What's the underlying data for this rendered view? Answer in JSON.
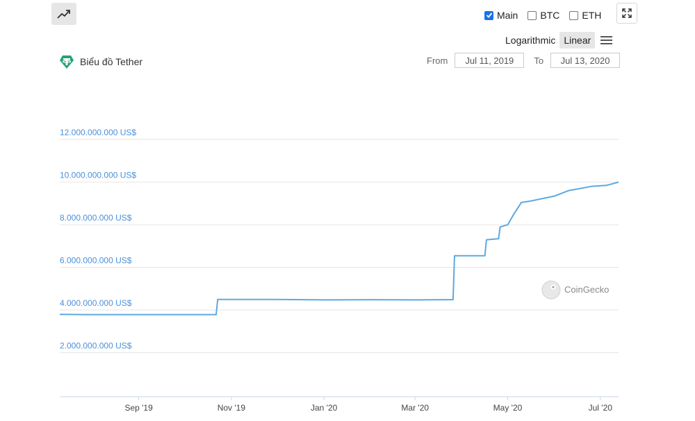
{
  "toolbar": {
    "series_toggles": [
      {
        "label": "Main",
        "checked": true
      },
      {
        "label": "BTC",
        "checked": false
      },
      {
        "label": "ETH",
        "checked": false
      }
    ],
    "scale_options": [
      {
        "label": "Logarithmic",
        "active": false
      },
      {
        "label": "Linear",
        "active": true
      }
    ]
  },
  "range": {
    "from_label": "From",
    "from_value": "Jul 11, 2019",
    "to_label": "To",
    "to_value": "Jul 13, 2020"
  },
  "watermark": "CoinGecko",
  "colors": {
    "line": "#5ca8e0",
    "accent": "#26a17b",
    "grid": "#e6e6e6"
  },
  "chart_data": {
    "type": "line",
    "title": "Biểu đồ Tether",
    "xlabel": "",
    "ylabel": "",
    "x_range": [
      "2019-07-11",
      "2020-07-13"
    ],
    "ylim": [
      0,
      12500000000
    ],
    "yticks": [
      {
        "value": 2000000000,
        "label": "2.000.000.000 US$"
      },
      {
        "value": 4000000000,
        "label": "4.000.000.000 US$"
      },
      {
        "value": 6000000000,
        "label": "6.000.000.000 US$"
      },
      {
        "value": 8000000000,
        "label": "8.000.000.000 US$"
      },
      {
        "value": 10000000000,
        "label": "10.000.000.000 US$"
      },
      {
        "value": 12000000000,
        "label": "12.000.000.000 US$"
      }
    ],
    "xticks": [
      {
        "date": "2019-09-01",
        "label": "Sep '19"
      },
      {
        "date": "2019-11-01",
        "label": "Nov '19"
      },
      {
        "date": "2020-01-01",
        "label": "Jan '20"
      },
      {
        "date": "2020-03-01",
        "label": "Mar '20"
      },
      {
        "date": "2020-05-01",
        "label": "May '20"
      },
      {
        "date": "2020-07-01",
        "label": "Jul '20"
      }
    ],
    "grid": true,
    "legend": "none",
    "series": [
      {
        "x": [
          "2019-07-11",
          "2019-08-01",
          "2019-09-01",
          "2019-10-01",
          "2019-10-22",
          "2019-10-23",
          "2019-12-01",
          "2020-01-01",
          "2020-02-01",
          "2020-03-01",
          "2020-03-20",
          "2020-03-26",
          "2020-03-27",
          "2020-04-05",
          "2020-04-16",
          "2020-04-17",
          "2020-04-25",
          "2020-04-26",
          "2020-05-01",
          "2020-05-05",
          "2020-05-10",
          "2020-05-15",
          "2020-06-01",
          "2020-06-10",
          "2020-06-25",
          "2020-07-05",
          "2020-07-13"
        ],
        "y": [
          3600000000,
          3590000000,
          3590000000,
          3590000000,
          3590000000,
          4300000000,
          4300000000,
          4280000000,
          4290000000,
          4280000000,
          4290000000,
          4290000000,
          6350000000,
          6350000000,
          6350000000,
          7100000000,
          7150000000,
          7700000000,
          7800000000,
          8300000000,
          8850000000,
          8900000000,
          9150000000,
          9400000000,
          9600000000,
          9650000000,
          9800000000
        ]
      }
    ]
  }
}
